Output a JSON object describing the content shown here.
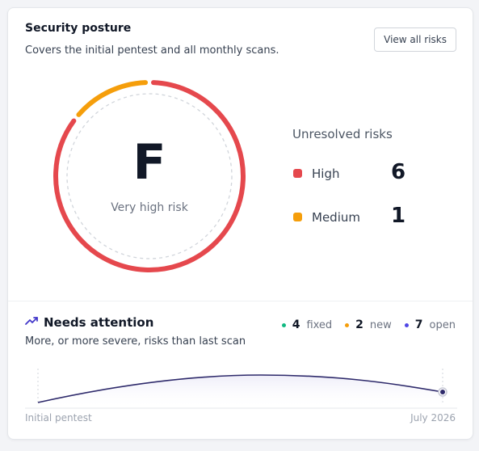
{
  "card": {
    "title": "Security posture",
    "subtitle": "Covers the initial pentest and all monthly scans.",
    "view_all_label": "View all risks"
  },
  "posture": {
    "grade": "F",
    "label": "Very high risk",
    "high_share": 0.857,
    "medium_share": 0.143
  },
  "unresolved": {
    "heading": "Unresolved risks",
    "items": [
      {
        "label": "High",
        "count": "6",
        "color": "#e5484d"
      },
      {
        "label": "Medium",
        "count": "1",
        "color": "#f59e0b"
      }
    ]
  },
  "attention": {
    "icon": "trend-up-icon",
    "title": "Needs attention",
    "subtitle": "More, or more severe, risks than last scan",
    "stats": [
      {
        "count": "4",
        "label": "fixed",
        "color": "#10b981"
      },
      {
        "count": "2",
        "label": "new",
        "color": "#f59e0b"
      },
      {
        "count": "7",
        "label": "open",
        "color": "#4f46e5"
      }
    ]
  },
  "trend": {
    "start_label": "Initial pentest",
    "end_label": "July 2026",
    "line_color": "#2e2a6b"
  }
}
